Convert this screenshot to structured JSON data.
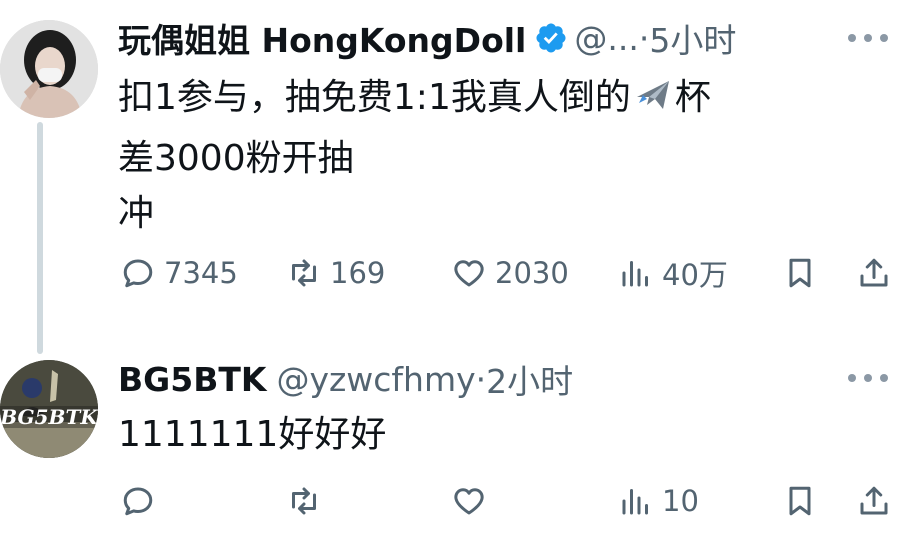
{
  "tweets": [
    {
      "author_name": "玩偶姐姐 HongKongDoll",
      "verified": true,
      "handle": "@...",
      "separator": "·",
      "time": "5小时",
      "body_line1_before_emoji": "扣1参与，抽免费1:1我真人倒的",
      "emoji": "airplane-emoji",
      "body_line1_after_emoji": "杯",
      "body_line2": "差3000粉开抽",
      "body_line3": "冲",
      "replies": "7345",
      "reposts": "169",
      "likes": "2030",
      "views": "40万"
    },
    {
      "author_name": "BG5BTK",
      "verified": false,
      "handle": "@yzwcfhmy",
      "separator": "·",
      "time": "2小时",
      "body": "1111111好好好",
      "replies": "",
      "reposts": "",
      "likes": "",
      "views": "10",
      "avatar_text": "BG5BTK"
    }
  ],
  "colors": {
    "text": "#0f1419",
    "secondary": "#536471",
    "verified_badge": "#1d9bf0",
    "thread_line": "#cfd9de"
  },
  "icons": [
    "reply-icon",
    "repost-icon",
    "like-icon",
    "views-icon",
    "bookmark-icon",
    "share-icon",
    "more-icon",
    "verified-icon"
  ]
}
